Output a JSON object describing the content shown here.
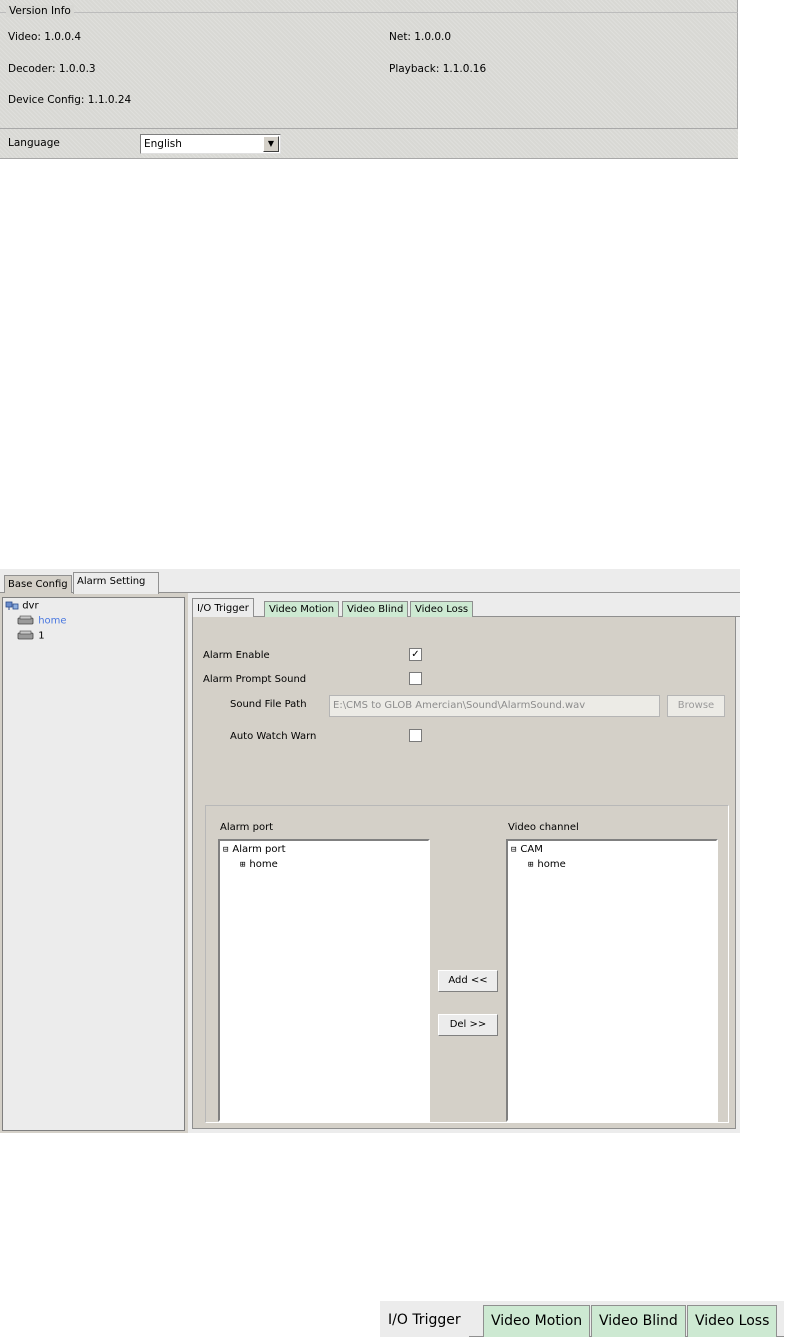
{
  "version_info": {
    "legend": "Version Info",
    "video": "Video: 1.0.0.4",
    "net": "Net: 1.0.0.0",
    "decoder": "Decoder: 1.0.0.3",
    "playback": "Playback: 1.1.0.16",
    "device_config": "Device Config: 1.1.0.24"
  },
  "language": {
    "label": "Language",
    "value": "English"
  },
  "alarm_dialog": {
    "top_tabs": [
      {
        "label": "Base Config",
        "active": false
      },
      {
        "label": "Alarm Setting",
        "active": true
      }
    ],
    "tree": {
      "root": "dvr",
      "children": [
        "home",
        "1"
      ]
    },
    "io_tabs": [
      {
        "label": "I/O Trigger",
        "active": true
      },
      {
        "label": "Video Motion",
        "active": false
      },
      {
        "label": "Video Blind",
        "active": false
      },
      {
        "label": "Video Loss",
        "active": false
      }
    ],
    "options": {
      "alarm_enable": {
        "label": "Alarm Enable",
        "checked": true
      },
      "alarm_prompt_sound": {
        "label": "Alarm Prompt Sound",
        "checked": false
      },
      "sound_file_path": {
        "label": "Sound File Path",
        "value": "E:\\CMS to GLOB Amercian\\Sound\\AlarmSound.wav",
        "browse_label": "Browse"
      },
      "auto_watch_warn": {
        "label": "Auto Watch Warn",
        "checked": false
      }
    },
    "alarm_port": {
      "header": "Alarm port",
      "tree_root": "Alarm port",
      "tree_child": "home"
    },
    "video_channel": {
      "header": "Video channel",
      "tree_root": "CAM",
      "tree_child": "home"
    },
    "buttons": {
      "add": "Add <<",
      "del": "Del >>"
    }
  },
  "zoom_tabs": [
    {
      "label": "I/O Trigger",
      "active": true
    },
    {
      "label": "Video Motion",
      "active": false
    },
    {
      "label": "Video Blind",
      "active": false
    },
    {
      "label": "Video Loss",
      "active": false
    }
  ],
  "colors": {
    "inactive_tab": "#cde9d2",
    "panel_gray": "#d4d0c8",
    "tree_link": "#4a78e0"
  },
  "icons": {
    "tree_root": "network-computer-icon",
    "tree_device": "dvr-device-icon"
  }
}
